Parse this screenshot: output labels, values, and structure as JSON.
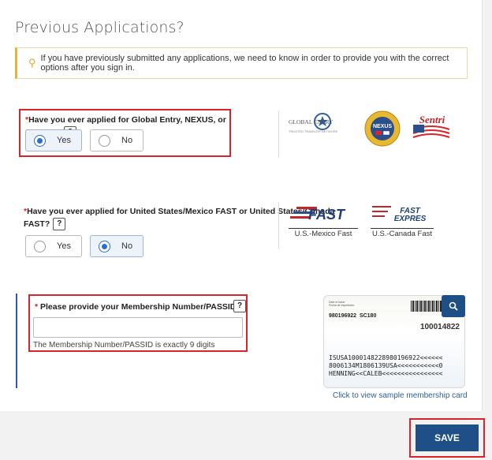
{
  "page": {
    "title": "Previous Applications?"
  },
  "notice": {
    "text": "If you have previously submitted any applications, we need to know in order to provide you with the correct options after you sign in."
  },
  "q1": {
    "asterisk": "*",
    "label": "Have you ever applied for Global Entry, NEXUS, or SENTRI?",
    "help": "?",
    "options": [
      {
        "label": "Yes",
        "selected": true
      },
      {
        "label": "No",
        "selected": false
      }
    ],
    "logos": {
      "global_entry": "GLOBAL ENTRY",
      "global_entry_sub": "TRUSTED TRAVELER NETWORK",
      "nexus": "NEXUS",
      "sentri": "Sentri"
    }
  },
  "q2": {
    "asterisk": "*",
    "label_line1": "Have you ever applied for United States/Mexico FAST or United States/Canada",
    "label_line2": "FAST?",
    "help": "?",
    "options": [
      {
        "label": "Yes",
        "selected": false
      },
      {
        "label": "No",
        "selected": true
      }
    ],
    "logos": [
      {
        "title": "FAST",
        "caption": "U.S.-Mexico Fast"
      },
      {
        "title": "FAST EXPRES",
        "caption": "U.S.-Canada Fast"
      }
    ]
  },
  "q3": {
    "asterisk": "*",
    "label": "Please provide your Membership Number/PASSID",
    "help": "?",
    "input_value": "",
    "hint": "The Membership Number/PASSID is exactly 9 digits"
  },
  "sample_card": {
    "passid": "980196922",
    "code": "SC180",
    "number": "100014822",
    "mrz": [
      "ISUSA1000148228980196922<<<<<<",
      "8006134M1806139USA<<<<<<<<<<<0",
      "HENNING<<CALEB<<<<<<<<<<<<<<<<"
    ],
    "caption": "Click to view sample membership card"
  },
  "actions": {
    "save": "SAVE"
  },
  "colors": {
    "accent": "#1f4f87",
    "highlight": "#d6262c",
    "notice_bar": "#e4b33a"
  }
}
